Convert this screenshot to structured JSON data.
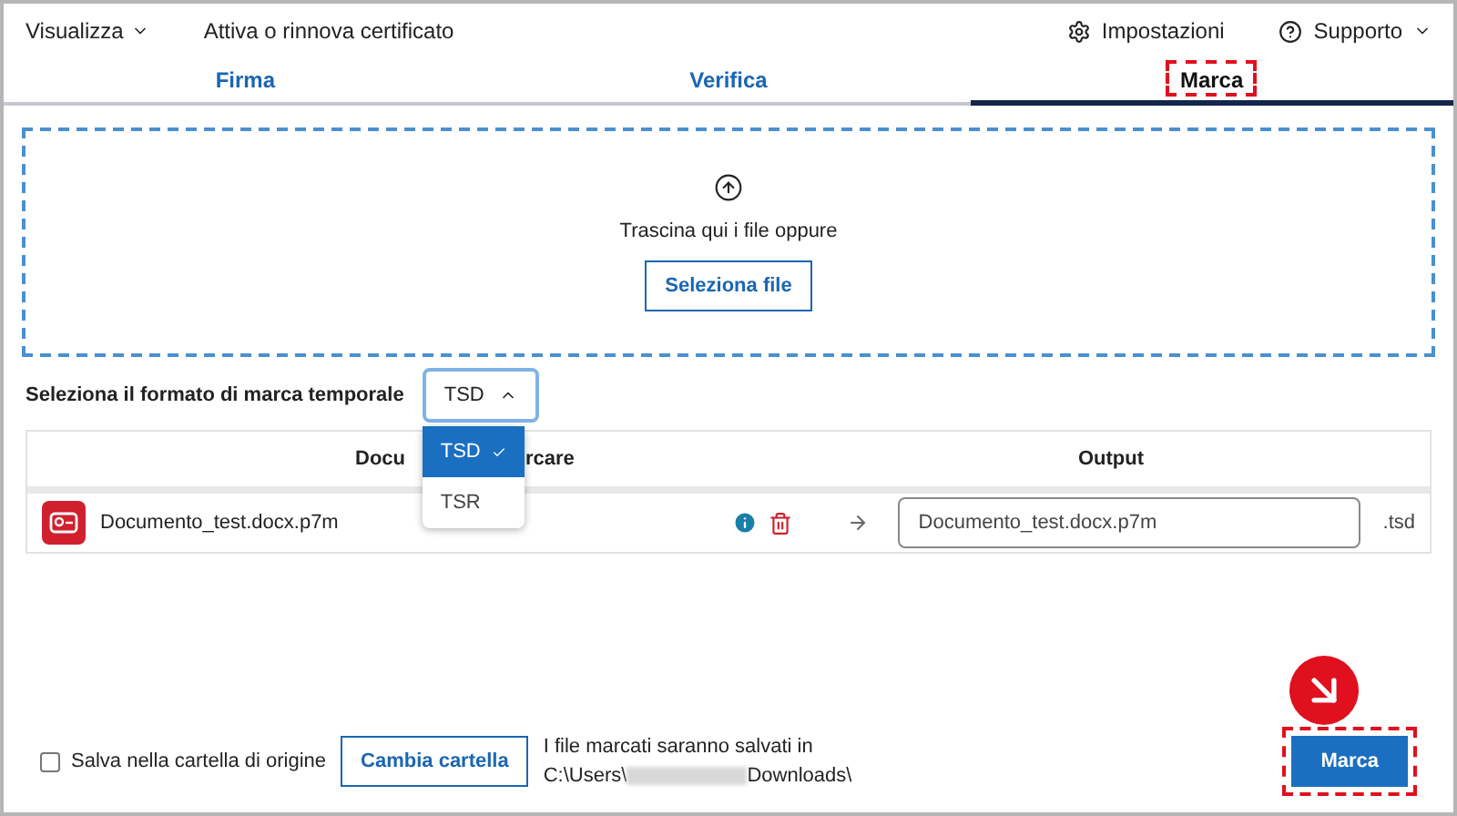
{
  "menu": [
    {
      "label": "Visualizza",
      "kind": "dropdown"
    },
    {
      "label": "Attiva o rinnova certificato",
      "kind": "link"
    }
  ],
  "actions": [
    {
      "label": "Impostazioni",
      "kind": "settings"
    },
    {
      "label": "Supporto",
      "kind": "help"
    }
  ],
  "tabs": [
    {
      "label": "Firma",
      "selected": false
    },
    {
      "label": "Verifica",
      "selected": false
    },
    {
      "label": "Marca",
      "selected": true
    }
  ],
  "drop_area": {
    "text": "Trascina qui i file oppure",
    "button": "Seleziona file"
  },
  "format": {
    "label": "Seleziona il formato di marca temporale",
    "value": "TSD",
    "expanded": true,
    "options": [
      {
        "label": "TSD",
        "selected": true
      },
      {
        "label": "TSR",
        "selected": false
      }
    ]
  },
  "table": {
    "columns": [
      {
        "parts": [
          "Docu",
          "rcare"
        ]
      },
      {
        "parts": [
          "Output"
        ]
      }
    ],
    "rows": [
      {
        "file": "Documento_test.docx.p7m",
        "output": "Documento_test.docx.p7m",
        "extension": ".tsd"
      }
    ]
  },
  "footer": {
    "checkbox": {
      "label": "Salva nella cartella di origine",
      "checked": false
    },
    "change_button": "Cambia cartella",
    "info": "I file marcati saranno salvati in",
    "path_start": "C:\\Users\\",
    "path_end": "Downloads\\",
    "submit": "Marca"
  }
}
